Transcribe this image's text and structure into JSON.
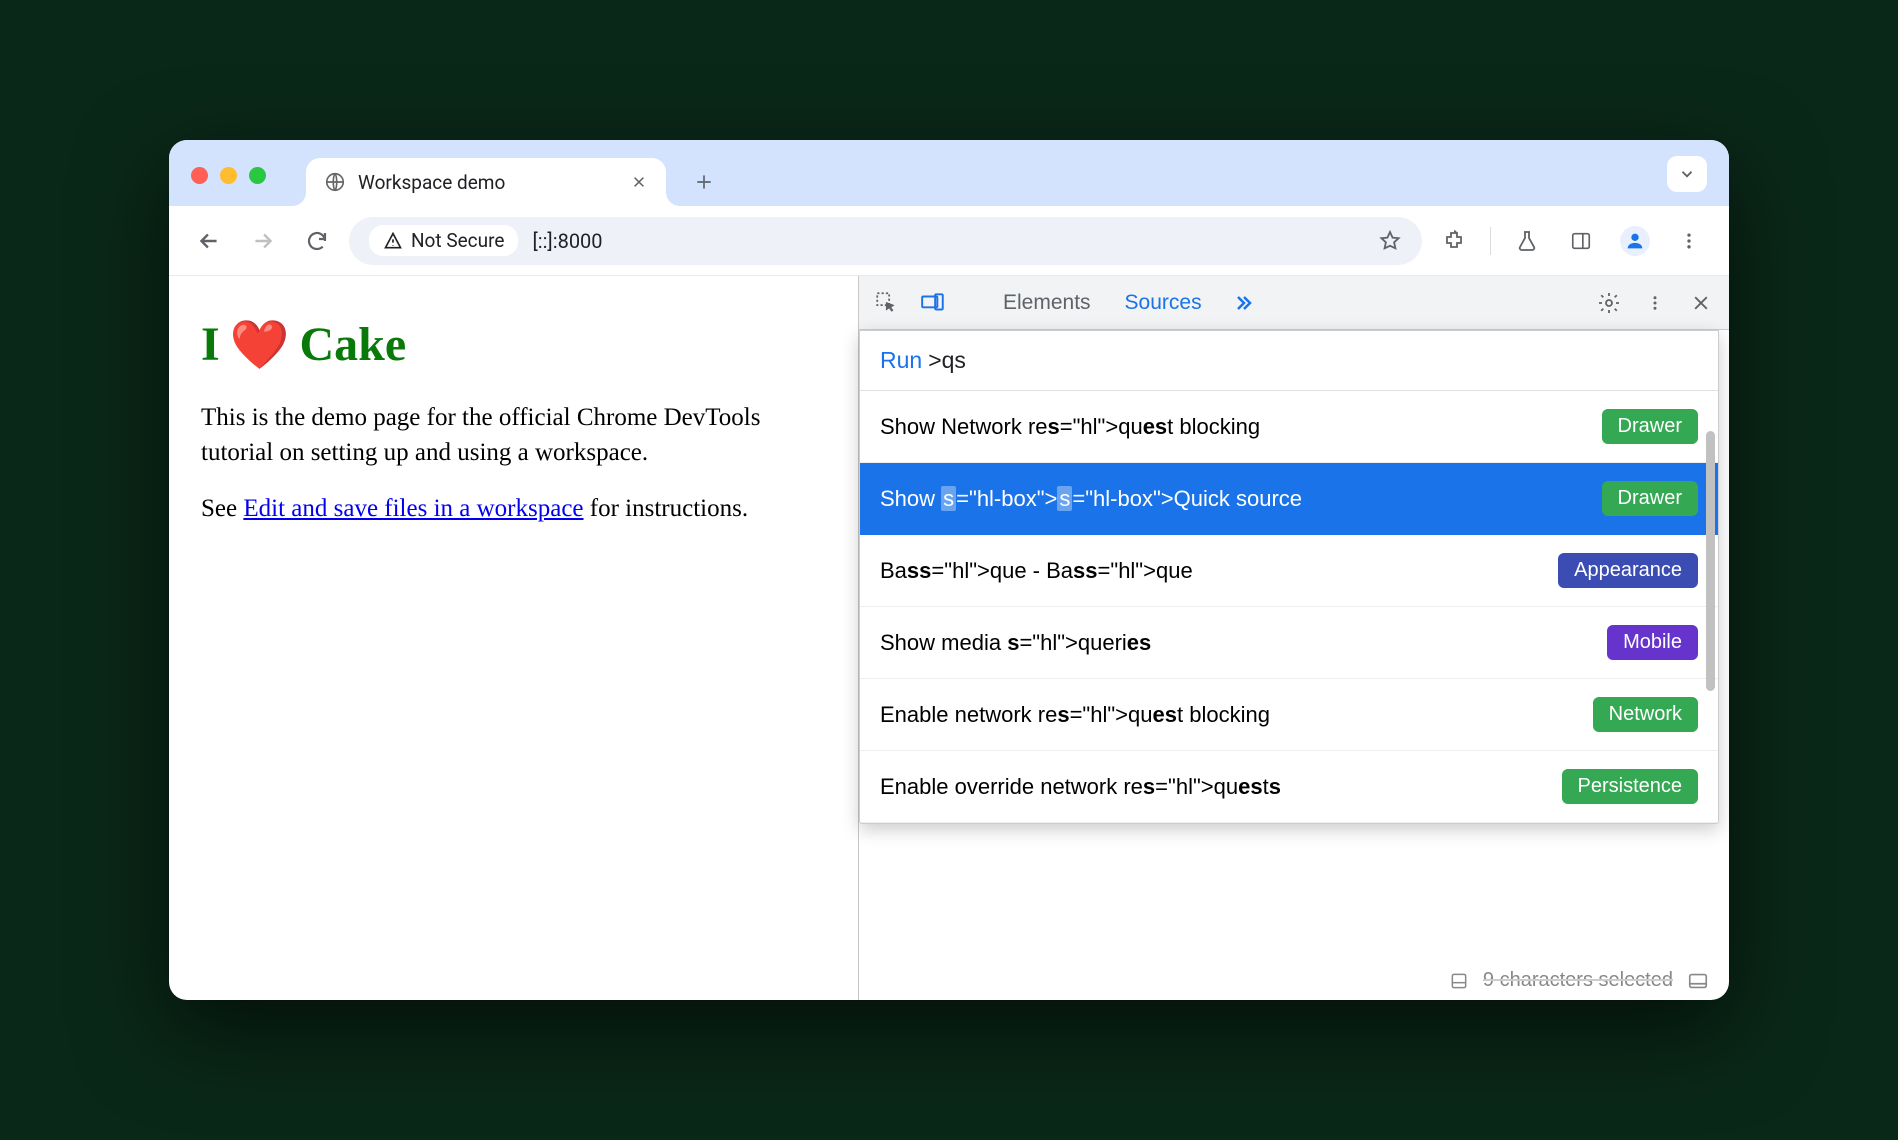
{
  "browser": {
    "tab_title": "Workspace demo",
    "security_label": "Not Secure",
    "url": "[::]:8000"
  },
  "page": {
    "h1_pre": "I",
    "h1_heart": "❤️",
    "h1_post": "Cake",
    "p1": "This is the demo page for the official Chrome DevTools tutorial on setting up and using a workspace.",
    "p2_pre": "See ",
    "p2_link": "Edit and save files in a workspace",
    "p2_post": " for instructions."
  },
  "devtools": {
    "tabs": {
      "elements": "Elements",
      "sources": "Sources"
    },
    "cmd": {
      "prefix": "Run",
      "query": ">qs",
      "items": [
        {
          "label": "Show Network request blocking",
          "badge": "Drawer",
          "badgeClass": "b-drawer",
          "selected": false
        },
        {
          "label": "Show Quick source",
          "badge": "Drawer",
          "badgeClass": "b-drawer",
          "selected": true
        },
        {
          "label": "Basque - Basque",
          "badge": "Appearance",
          "badgeClass": "b-appearance",
          "selected": false
        },
        {
          "label": "Show media queries",
          "badge": "Mobile",
          "badgeClass": "b-mobile",
          "selected": false
        },
        {
          "label": "Enable network request blocking",
          "badge": "Network",
          "badgeClass": "b-network",
          "selected": false
        },
        {
          "label": "Enable override network requests",
          "badge": "Persistence",
          "badgeClass": "b-persistence",
          "selected": false
        }
      ]
    },
    "footer_text": "9 characters selected"
  }
}
